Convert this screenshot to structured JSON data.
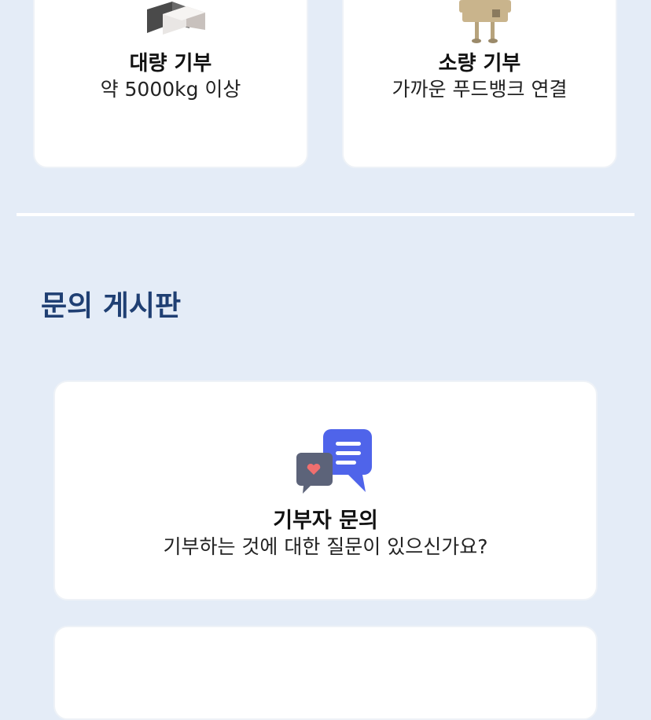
{
  "donation": {
    "bulk": {
      "title": "대량 기부",
      "subtitle": "약 5000kg 이상",
      "icon": "boxes-icon"
    },
    "small": {
      "title": "소량 기부",
      "subtitle": "가까운 푸드뱅크 연결",
      "icon": "box-character-icon"
    }
  },
  "board": {
    "section_title": "문의 게시판",
    "donor_inquiry": {
      "title": "기부자 문의",
      "subtitle": "기부하는 것에 대한 질문이 있으신가요?",
      "icon": "chat-bubbles-icon"
    }
  },
  "colors": {
    "background": "#e4ecf7",
    "section_title": "#1f3f73",
    "chat_blue": "#4f64ea",
    "chat_gray": "#5c6379",
    "heart": "#f06f6f"
  }
}
